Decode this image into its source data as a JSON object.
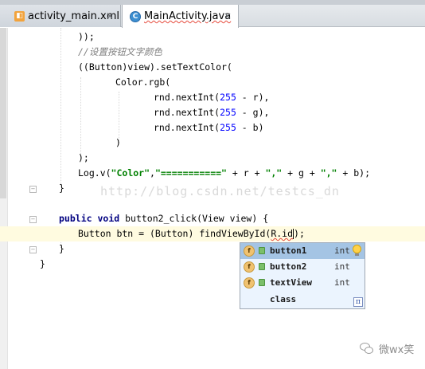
{
  "tabs": [
    {
      "label": "activity_main.xml",
      "icon": "xml-file-icon",
      "close": "×"
    },
    {
      "label": "MainActivity.java",
      "icon": "java-class-icon",
      "close": "×"
    }
  ],
  "code": {
    "l1": "));",
    "l2": "//设置按钮文字颜色",
    "l3": "((Button)view).setTextColor(",
    "l4": "Color.rgb(",
    "l5a": "rnd.nextInt(",
    "l5n": "255",
    "l5b": " - r),",
    "l6a": "rnd.nextInt(",
    "l6n": "255",
    "l6b": " - g),",
    "l7a": "rnd.nextInt(",
    "l7n": "255",
    "l7b": " - b)",
    "l8": ")",
    "l9": ");",
    "l10a": "Log.v(",
    "l10s1": "\"Color\"",
    "l10c": ",",
    "l10s2": "\"===========\"",
    "l10d": " + r + ",
    "l10s3": "\",\"",
    "l10e": " + g + ",
    "l10s4": "\",\"",
    "l10f": " + b);",
    "l11": "}",
    "l12k1": "public",
    "l12k2": "void",
    "l12": " button2_click(View view) {",
    "l13a": "Button btn = (Button) findViewById(",
    "l13b": "R.id",
    "l13c": ");",
    "l14": "}",
    "l15": "}"
  },
  "watermark": "http://blog.csdn.net/testcs_dn",
  "completion": {
    "items": [
      {
        "name": "button1",
        "type": "int",
        "icon": "field-icon",
        "selected": true
      },
      {
        "name": "button2",
        "type": "int",
        "icon": "field-icon"
      },
      {
        "name": "textView",
        "type": "int",
        "icon": "field-icon"
      },
      {
        "name": "class",
        "type": ""
      }
    ],
    "pi_label": "π"
  },
  "wechat": {
    "text": "微wx笑"
  }
}
